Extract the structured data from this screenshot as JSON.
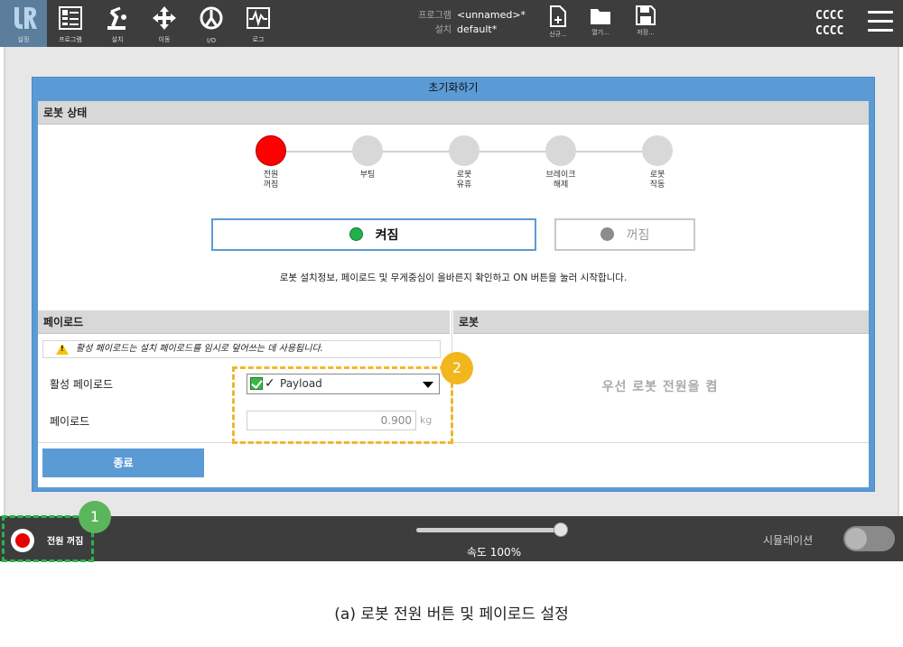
{
  "nav": {
    "items": [
      {
        "label": "설정",
        "icon": "ur-logo-icon"
      },
      {
        "label": "프로그램",
        "icon": "program-icon"
      },
      {
        "label": "설치",
        "icon": "installation-icon"
      },
      {
        "label": "이동",
        "icon": "move-icon"
      },
      {
        "label": "I/O",
        "icon": "io-icon"
      },
      {
        "label": "로그",
        "icon": "log-icon"
      }
    ]
  },
  "file": {
    "program_label": "프로그램",
    "program_value": "<unnamed>*",
    "install_label": "설치",
    "install_value": "default*",
    "new_label": "신규...",
    "open_label": "열기...",
    "save_label": "저장..."
  },
  "header": {
    "cccc_top": "CCCC",
    "cccc_bottom": "CCCC"
  },
  "dialog": {
    "title": "초기화하기",
    "robot_state_header": "로봇 상태",
    "steps": [
      {
        "label": "전원\n꺼짐",
        "active": true
      },
      {
        "label": "부팅",
        "active": false
      },
      {
        "label": "로봇\n유휴",
        "active": false
      },
      {
        "label": "브레이크\n해제",
        "active": false
      },
      {
        "label": "로봇\n작동",
        "active": false
      }
    ],
    "on_label": "켜짐",
    "off_label": "꺼짐",
    "instruction": "로봇 설치정보, 페이로드 및 무게중심이 올바른지 확인하고 ON 버튼을 눌러 시작합니다.",
    "payload_header": "페이로드",
    "robot_header": "로봇",
    "warning": "활성 페이로드는 설치 페이로드를 임시로 덮어쓰는 데 사용됩니다.",
    "active_payload_label": "활성 페이로드",
    "active_payload_value": "Payload",
    "payload_label": "페이로드",
    "payload_value": "0.900",
    "payload_unit": "kg",
    "robot_message": "우선 로봇 전원을 켬",
    "close_label": "종료"
  },
  "annotations": {
    "badge1": "1",
    "badge2": "2"
  },
  "footer": {
    "power_label": "전원 꺼짐",
    "speed_label": "속도 100%",
    "speed_percent": 100,
    "simulation_label": "시뮬레이션",
    "simulation_on": false
  },
  "caption": "(a) 로봇 전원 버튼 및 페이로드 설정",
  "colors": {
    "accent": "#5b9bd5",
    "topbar": "#3d3d3d",
    "on_green": "#22b24c",
    "power_red": "#ff0000",
    "highlight_orange": "#f0b62a",
    "highlight_green": "#2bb24c"
  }
}
